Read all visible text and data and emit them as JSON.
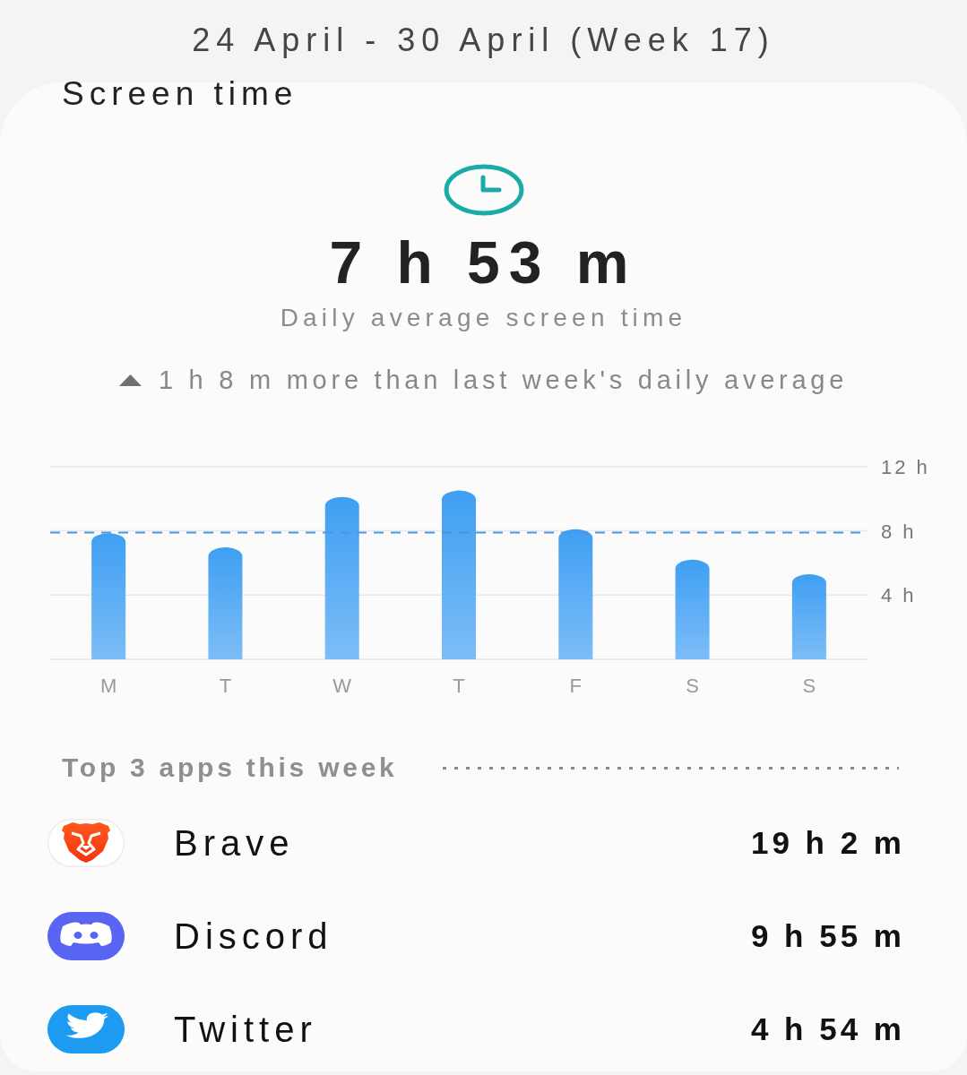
{
  "header": {
    "date_range": "24 April - 30 April (Week 17)"
  },
  "card": {
    "title": "Screen time",
    "average": "7 h 53 m",
    "average_label": "Daily average screen time",
    "comparison": {
      "text": "1 h 8 m more than last week's daily average"
    },
    "chart_data": {
      "type": "bar",
      "categories": [
        "M",
        "T",
        "W",
        "T",
        "F",
        "S",
        "S"
      ],
      "values": [
        7.85,
        6.97,
        10.1,
        10.5,
        8.1,
        6.2,
        5.3
      ],
      "ylim": [
        0,
        12
      ],
      "yticks": [
        {
          "value": 4,
          "label": "4 h"
        },
        {
          "value": 8,
          "label": "8 h"
        },
        {
          "value": 12,
          "label": "12 h"
        }
      ],
      "ref_lines": [
        {
          "axis": "y",
          "value": 7.88
        }
      ]
    }
  },
  "top_apps": {
    "title": "Top 3 apps this week",
    "apps": [
      {
        "name": "Brave",
        "time": "19 h 2 m"
      },
      {
        "name": "Discord",
        "time": "9 h 55 m"
      },
      {
        "name": "Twitter",
        "time": "4 h 54 m"
      }
    ]
  }
}
